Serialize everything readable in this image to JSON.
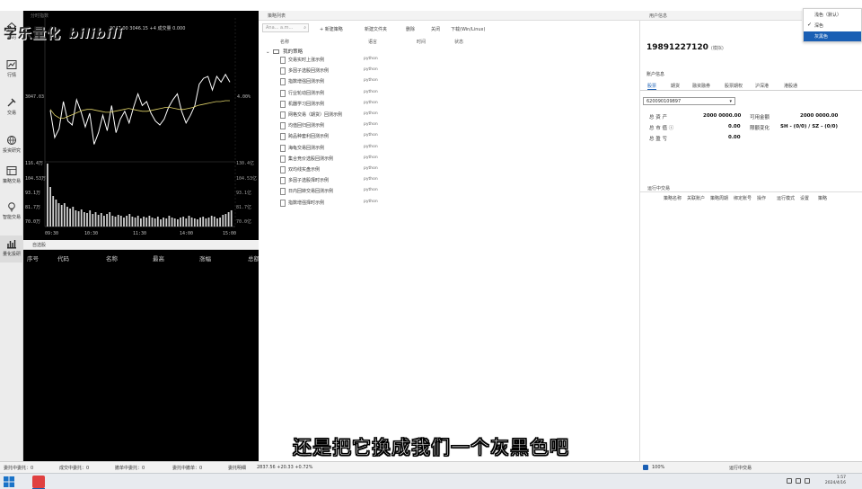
{
  "watermark": {
    "text": "字乐量化",
    "bilibili": "bilibili"
  },
  "nav": {
    "items": [
      {
        "label": "我的",
        "icon": "home-icon"
      },
      {
        "label": "行情",
        "icon": "line-chart-icon"
      },
      {
        "label": "交易",
        "icon": "hammer-icon"
      },
      {
        "label": "投资研究",
        "icon": "globe-icon"
      },
      {
        "label": "策略交易",
        "icon": "table-icon"
      },
      {
        "label": "智能交易",
        "icon": "bulb-icon"
      },
      {
        "label": "量化投研",
        "icon": "bar-chart-icon"
      }
    ]
  },
  "chart": {
    "tab": "分时指数",
    "info": "3047.00   3046.15   +4 成交量  0.000",
    "left_top": "3047.03",
    "right_mid": "4.00%",
    "vol_left": [
      "116.4万",
      "104.53万",
      "93.1万",
      "81.7万",
      "70.0万"
    ],
    "vol_right": [
      "130.4亿",
      "104.53亿",
      "93.1亿",
      "81.7亿",
      "70.0亿"
    ],
    "time_ticks": [
      "09:30",
      "10:30",
      "11:30",
      "14:00",
      "15:00"
    ]
  },
  "chart_data": {
    "type": "line",
    "x": [
      "09:30",
      "10:30",
      "11:30",
      "14:00",
      "15:00"
    ],
    "series": [
      {
        "values": [
          47,
          75,
          66,
          38,
          58,
          62,
          36,
          48,
          64,
          50,
          82,
          70,
          52,
          68,
          42,
          70,
          56,
          48,
          60,
          44,
          30,
          42,
          38,
          50,
          58,
          62,
          56,
          44,
          36,
          30,
          48,
          60,
          52,
          42,
          20,
          14,
          12,
          26,
          12,
          18,
          10,
          18
        ]
      },
      {
        "values": [
          46,
          52,
          55,
          55,
          53,
          51,
          49,
          47,
          46,
          46,
          47,
          48,
          49,
          49,
          48,
          47,
          46,
          45,
          46,
          47,
          48,
          48,
          47,
          46,
          45,
          44,
          44,
          45,
          46,
          46,
          45,
          44,
          42,
          41,
          40,
          39,
          38,
          38,
          37,
          37
        ]
      }
    ],
    "volume": [
      70,
      44,
      34,
      30,
      26,
      24,
      26,
      22,
      20,
      22,
      18,
      17,
      19,
      16,
      15,
      18,
      14,
      16,
      13,
      15,
      12,
      14,
      16,
      12,
      11,
      13,
      12,
      10,
      12,
      14,
      11,
      10,
      12,
      9,
      11,
      10,
      12,
      10,
      9,
      11,
      8,
      10,
      9,
      12,
      10,
      9,
      8,
      10,
      11,
      9,
      12,
      10,
      9,
      8,
      10,
      11,
      9,
      10,
      12,
      11,
      9,
      10,
      13,
      14,
      16,
      18
    ]
  },
  "watchlist": {
    "tab": "自选股",
    "headers": [
      "序号",
      "代码",
      "名称",
      "最高",
      "涨幅",
      "总额"
    ]
  },
  "strategy": {
    "header": "策略列表",
    "search_placeholder": "Ana... a.m...",
    "toolbar": [
      "+ 新建策略",
      "新建文件夹",
      "删除",
      "关闭",
      "下载(Win/Linux)"
    ],
    "columns": [
      "名称",
      "语言",
      "时间",
      "状态"
    ],
    "folder": "我的策略",
    "rows": [
      {
        "name": "交易实时上涨示例",
        "lang": "python"
      },
      {
        "name": "多因子选股回测示例",
        "lang": "python"
      },
      {
        "name": "指数增强回测示例",
        "lang": "python"
      },
      {
        "name": "行业轮动回测示例",
        "lang": "python"
      },
      {
        "name": "机器学习回测示例",
        "lang": "python"
      },
      {
        "name": "网格交易（期货）回测示例",
        "lang": "python"
      },
      {
        "name": "均值回归回测示例",
        "lang": "python"
      },
      {
        "name": "跨品种套利回测示例",
        "lang": "python"
      },
      {
        "name": "海龟交易回测示例",
        "lang": "python"
      },
      {
        "name": "集合竞价选股回测示例",
        "lang": "python"
      },
      {
        "name": "双均线实盘示例",
        "lang": "python"
      },
      {
        "name": "多因子选股择时示例",
        "lang": "python"
      },
      {
        "name": "日内回转交易回测示例",
        "lang": "python"
      },
      {
        "name": "指数增强择时示例",
        "lang": "python"
      }
    ]
  },
  "account": {
    "header": "用户信息",
    "id": "19891227120",
    "id_tag": "(模拟)",
    "info_title": "账户信息",
    "tabs": [
      "股票",
      "期货",
      "融资融券",
      "股票期权",
      "沪深港",
      "港股通"
    ],
    "selected_account": "620090109897",
    "rows": [
      {
        "label": "总 资 产",
        "value": "2000 0000.00",
        "label2": "可用金额",
        "value2": "2000 0000.00"
      },
      {
        "label": "总 市 值 ⓘ",
        "value": "0.00",
        "label2": "限额变化",
        "value2": "SH - (0/0) / SZ - (0/0)"
      },
      {
        "label": "总 盈 亏",
        "value": "0.00"
      }
    ],
    "trade_title": "运行中交易",
    "trade_headers": [
      "策略名称",
      "关联账户",
      "策略周期",
      "绑定账号",
      "操作",
      "运行模式",
      "设置",
      "策略"
    ]
  },
  "dropdown": {
    "items": [
      "浅色（默认）",
      "深色",
      "灰黑色"
    ],
    "checked_index": 1,
    "selected_index": 2
  },
  "status": {
    "items": [
      "委托中委托：0",
      "成交中委托：0",
      "撤单中委托：0",
      "委托中撤单：0",
      "委托明细"
    ],
    "index": "2837.56  +20.33  +0.72%",
    "zoom": "100%",
    "right_text": "运行中交易"
  },
  "taskbar": {
    "time": "1:57",
    "date": "2024/4/16"
  },
  "subtitle": "还是把它换成我们一个灰黑色吧"
}
